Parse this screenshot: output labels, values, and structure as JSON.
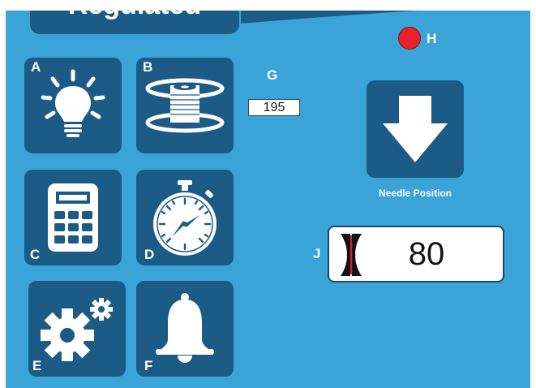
{
  "header": {
    "title": "Regulated"
  },
  "tiles": {
    "A": {
      "label": "A",
      "icon": "lightbulb-icon"
    },
    "B": {
      "label": "B",
      "icon": "spool-icon"
    },
    "C": {
      "label": "C",
      "icon": "calculator-icon"
    },
    "D": {
      "label": "D",
      "icon": "stopwatch-icon"
    },
    "E": {
      "label": "E",
      "icon": "gears-icon"
    },
    "F": {
      "label": "F",
      "icon": "bell-icon"
    }
  },
  "g": {
    "label": "G",
    "value": "195"
  },
  "h": {
    "label": "H",
    "color": "#e8212b"
  },
  "needle": {
    "label": "Needle Position",
    "icon": "arrow-down-icon"
  },
  "j": {
    "label": "J",
    "value": "80",
    "icon": "stitch-width-icon"
  },
  "colors": {
    "background": "#3aa3d8",
    "tile": "#1b5b86",
    "indicator": "#e8212b"
  }
}
